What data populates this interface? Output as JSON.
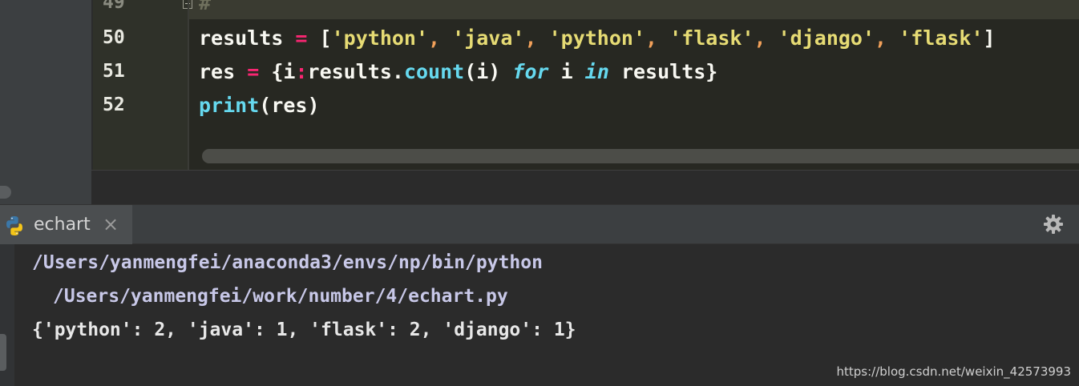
{
  "editor": {
    "line_numbers": [
      "49",
      "50",
      "51",
      "52"
    ],
    "line49": "#",
    "line50": {
      "var": "results",
      "eq": "=",
      "open": "[",
      "items": [
        "'python'",
        "'java'",
        "'python'",
        "'flask'",
        "'django'",
        "'flask'"
      ],
      "comma": ",",
      "close": "]"
    },
    "line51": {
      "var": "res",
      "eq": "=",
      "p1": "{i",
      "colon": ":",
      "p2": "results.",
      "fn": "count",
      "p3": "(i)",
      "kw_for": "for",
      "p4": "i",
      "kw_in": "in",
      "p5": "results}"
    },
    "line52": {
      "fn": "print",
      "rest": "(res)"
    }
  },
  "run_panel": {
    "tab_label": "echart",
    "close_symbol": "×",
    "icons": [
      "python-icon",
      "close-icon",
      "gear-icon"
    ]
  },
  "console": {
    "line1": "/Users/yanmengfei/anaconda3/envs/np/bin/python",
    "line2": "/Users/yanmengfei/work/number/4/echart.py",
    "line3": "{'python': 2, 'java': 1, 'flask': 2, 'django': 1}"
  },
  "watermark": "https://blog.csdn.net/weixin_42573993",
  "colors": {
    "editor_bg": "#272822",
    "string": "#e6db74",
    "operator": "#f92672",
    "builtin": "#66d9ef",
    "console_bg": "#2b2b2b"
  }
}
